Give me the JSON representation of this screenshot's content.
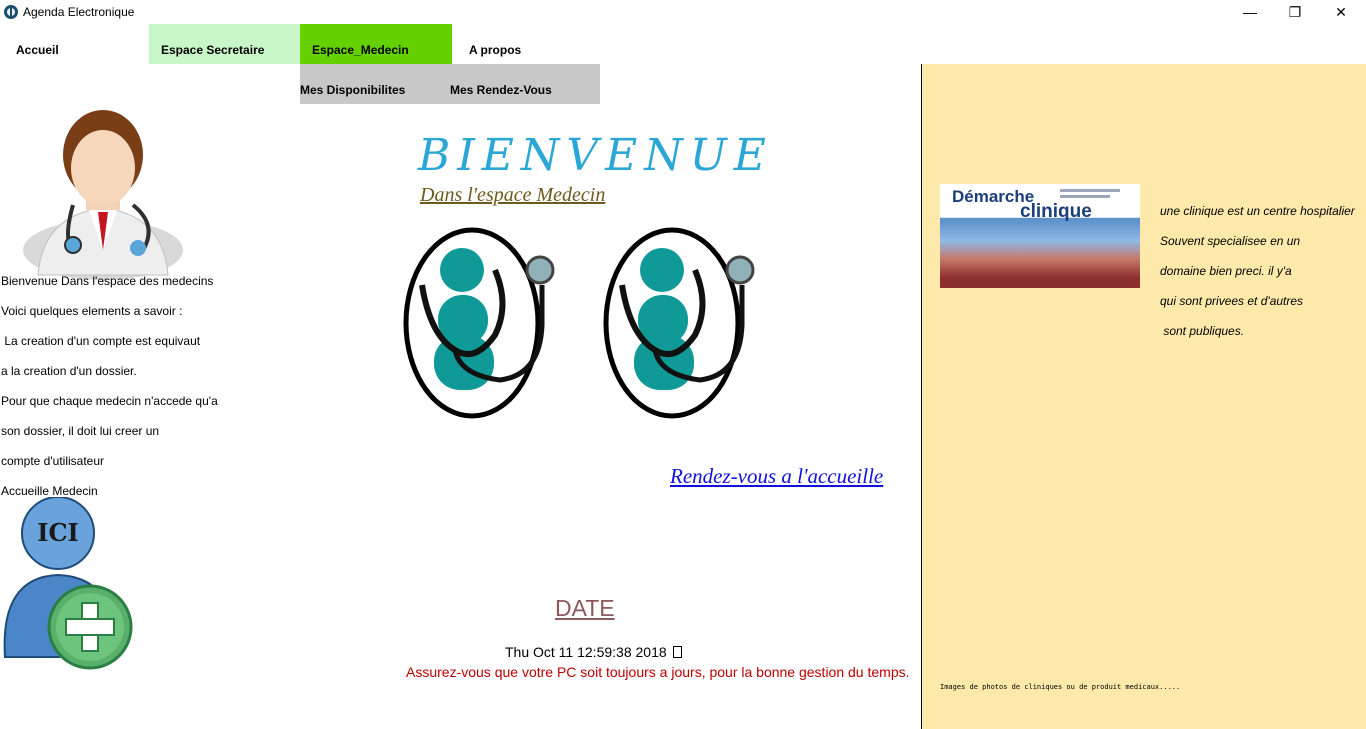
{
  "window": {
    "title": "Agenda Electronique",
    "controls": {
      "minimize": "—",
      "maximize": "❐",
      "close": "✕"
    }
  },
  "menu": {
    "items": [
      {
        "label": "Accueil",
        "bg": "#ffffff"
      },
      {
        "label": "Espace Secretaire",
        "bg": "#c9f7c9"
      },
      {
        "label": "Espace_Medecin",
        "bg": "#66d100"
      },
      {
        "label": "A propos",
        "bg": "#ffffff"
      }
    ],
    "submenu": [
      {
        "label": "Mes Disponibilites"
      },
      {
        "label": "Mes Rendez-Vous"
      }
    ],
    "submenu_bg": "#c8c8c8"
  },
  "left": {
    "lines": [
      "Bienvenue Dans l'espace des medecins",
      "Voici quelques elements a savoir :",
      " La creation d'un compte est equivaut",
      "a la creation d'un dossier.",
      "Pour que chaque medecin n'accede qu'a",
      "son dossier, il doit lui creer un",
      "compte d'utilisateur"
    ],
    "link_label": "Accueille Medecin",
    "ici_text": "ICI"
  },
  "center": {
    "welcome": "BIENVENUE",
    "subtitle": "Dans l'espace Medecin",
    "rdv_link": "Rendez-vous a l'accueille",
    "date_label": "DATE",
    "date_value": "Thu Oct 11 12:59:38 2018",
    "date_warning": "Assurez-vous que votre PC soit toujours a jours, pour la bonne gestion du temps."
  },
  "right": {
    "book_title_line1": "Démarche",
    "book_title_line2": "clinique",
    "lines": [
      "une clinique est un centre hospitalier",
      "Souvent specialisee en un",
      "domaine bien preci. il y'a",
      "qui sont privees et d'autres",
      " sont publiques."
    ],
    "caption": "Images de photos de cliniques ou de produit medicaux....."
  },
  "colors": {
    "accent_green": "#66d100",
    "light_green": "#c9f7c9",
    "panel_bg": "#fde9aa",
    "welcome": "#2aa7d6",
    "link": "#1010e0",
    "warning": "#c00000",
    "teal": "#0f9a97"
  }
}
